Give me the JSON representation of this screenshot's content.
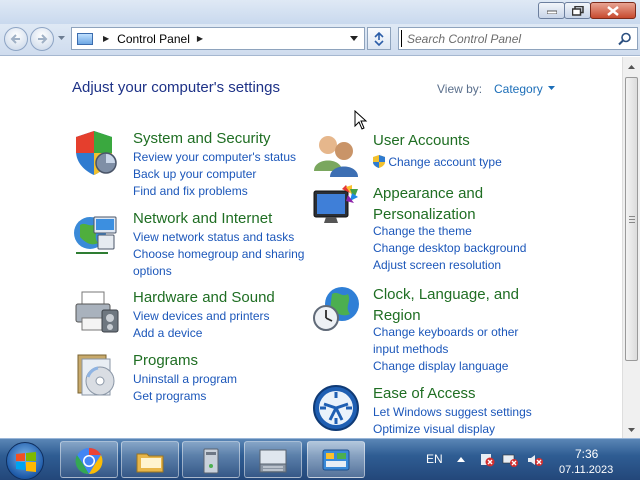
{
  "window": {
    "minimize_icon": "minimize-icon",
    "maximize_icon": "restore-icon",
    "close_icon": "close-icon"
  },
  "nav": {
    "address_path": "Control Panel",
    "search_placeholder": "Search Control Panel"
  },
  "content": {
    "title": "Adjust your computer's settings",
    "view_by_label": "View by:",
    "view_by_value": "Category"
  },
  "categories_left": [
    {
      "title": "System and Security",
      "icon": "shield-icon",
      "links": [
        "Review your computer's status",
        "Back up your computer",
        "Find and fix problems"
      ]
    },
    {
      "title": "Network and Internet",
      "icon": "network-globe-icon",
      "links": [
        "View network status and tasks",
        "Choose homegroup and sharing",
        "options"
      ]
    },
    {
      "title": "Hardware and Sound",
      "icon": "printer-icon",
      "links": [
        "View devices and printers",
        "Add a device"
      ]
    },
    {
      "title": "Programs",
      "icon": "programs-disc-icon",
      "links": [
        "Uninstall a program",
        "Get programs"
      ]
    }
  ],
  "categories_right": [
    {
      "title": "User Accounts",
      "icon": "users-icon",
      "links": [
        "Change account type"
      ]
    },
    {
      "title_lines": [
        "Appearance and",
        "Personalization"
      ],
      "icon": "monitor-palette-icon",
      "links": [
        "Change the theme",
        "Change desktop background",
        "Adjust screen resolution"
      ]
    },
    {
      "title_lines": [
        "Clock, Language, and",
        "Region"
      ],
      "icon": "globe-clock-icon",
      "links": [
        "Change keyboards or other",
        "input methods",
        "Change display language"
      ]
    },
    {
      "title": "Ease of Access",
      "icon": "ease-of-access-icon",
      "links": [
        "Let Windows suggest settings",
        "Optimize visual display"
      ]
    }
  ],
  "taskbar": {
    "language": "EN",
    "time": "7:36",
    "date": "07.11.2023",
    "apps": [
      "chrome-icon",
      "file-explorer-icon",
      "computer-icon",
      "keyboard-icon",
      "control-panel-icon"
    ]
  }
}
